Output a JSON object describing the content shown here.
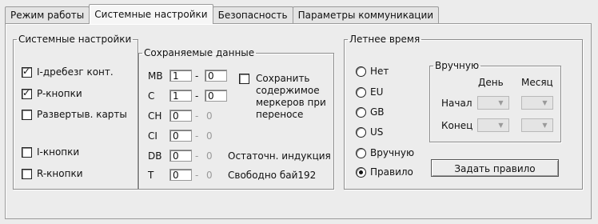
{
  "tabs": [
    "Режим работы",
    "Системные настройки",
    "Безопасность",
    "Параметры коммуникации"
  ],
  "system_settings": {
    "title": "Системные настройки",
    "checkboxes": [
      {
        "label": "I-дребезг конт.",
        "checked": true
      },
      {
        "label": "P-кнопки",
        "checked": true
      },
      {
        "label": "Развертыв. карты",
        "checked": false
      },
      {
        "label": "I-кнопки",
        "checked": false
      },
      {
        "label": "R-кнопки",
        "checked": false
      }
    ]
  },
  "saved_data": {
    "title": "Сохраняемые данные",
    "rows": [
      {
        "label": "MB",
        "from": "1",
        "to": "0",
        "to_gray": false
      },
      {
        "label": "C",
        "from": "1",
        "to": "0",
        "to_gray": false
      },
      {
        "label": "CH",
        "from": "0",
        "to": "0",
        "to_gray": true
      },
      {
        "label": "CI",
        "from": "0",
        "to": "0",
        "to_gray": true
      },
      {
        "label": "DB",
        "from": "0",
        "to": "0",
        "to_gray": true
      },
      {
        "label": "T",
        "from": "0",
        "to": "0",
        "to_gray": true
      }
    ],
    "dash": "-",
    "save_markers": {
      "label_lines": [
        "Сохранить",
        "содержимое",
        "меркеров при",
        "переносе"
      ],
      "checked": false
    },
    "residual_label": "Остаточн. индукция",
    "free_label": "Свободно бай192"
  },
  "summer_time": {
    "title": "Летнее время",
    "radios": [
      {
        "label": "Нет",
        "selected": false
      },
      {
        "label": "EU",
        "selected": false
      },
      {
        "label": "GB",
        "selected": false
      },
      {
        "label": "US",
        "selected": false
      },
      {
        "label": "Вручную",
        "selected": false
      },
      {
        "label": "Правило",
        "selected": true
      }
    ],
    "manual": {
      "title": "Вручную",
      "col_day": "День",
      "col_month": "Месяц",
      "row_start": "Начал",
      "row_end": "Конец"
    },
    "set_rule_button": "Задать правило"
  }
}
